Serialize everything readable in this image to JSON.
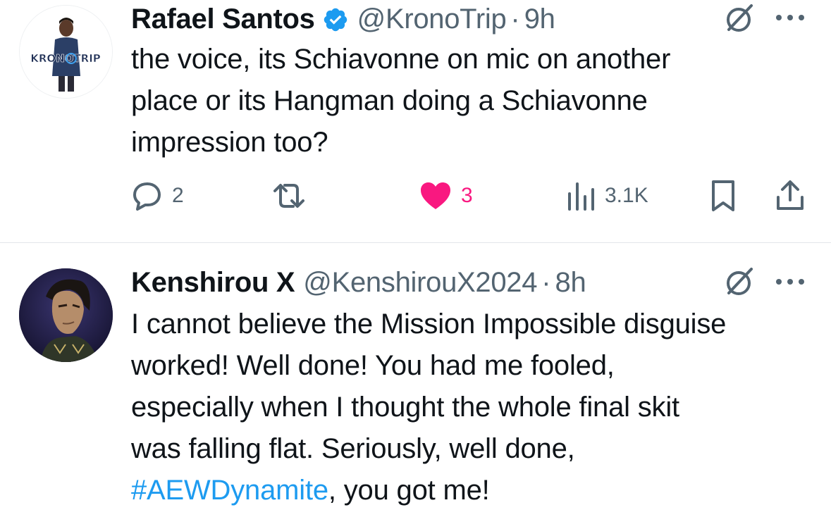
{
  "tweets": [
    {
      "display_name": "Rafael Santos",
      "verified": true,
      "handle": "@KronoTrip",
      "separator": "·",
      "time": "9h",
      "avatar_text": "KRONOTRIP",
      "text_lines": [
        "the voice, its Schiavonne on mic on another",
        "place or its Hangman doing a Schiavonne",
        "impression too?"
      ],
      "actions": {
        "replies": "2",
        "reposts": "",
        "likes": "3",
        "liked": true,
        "views": "3.1K"
      }
    },
    {
      "display_name": "Kenshirou X",
      "verified": false,
      "handle": "@KenshirouX2024",
      "separator": "·",
      "time": "8h",
      "text_lines": [
        "I cannot believe the Mission Impossible disguise",
        "worked!  Well done! You had me fooled,",
        "especially when I thought the whole final skit",
        "was falling flat. Seriously, well done,"
      ],
      "last_line": {
        "hashtag": "#AEWDynamite",
        "rest": ", you got me!"
      }
    }
  ],
  "icons": {
    "verified": "verified-badge-icon",
    "grok": "grok-icon",
    "more": "more-dots-icon",
    "reply": "reply-icon",
    "repost": "repost-icon",
    "like": "heart-icon",
    "views": "views-chart-icon",
    "bookmark": "bookmark-icon",
    "share": "share-icon"
  },
  "colors": {
    "text": "#0f1419",
    "secondary": "#536471",
    "accent": "#1d9bf0",
    "like": "#f91880",
    "divider": "#e3e6ea"
  }
}
